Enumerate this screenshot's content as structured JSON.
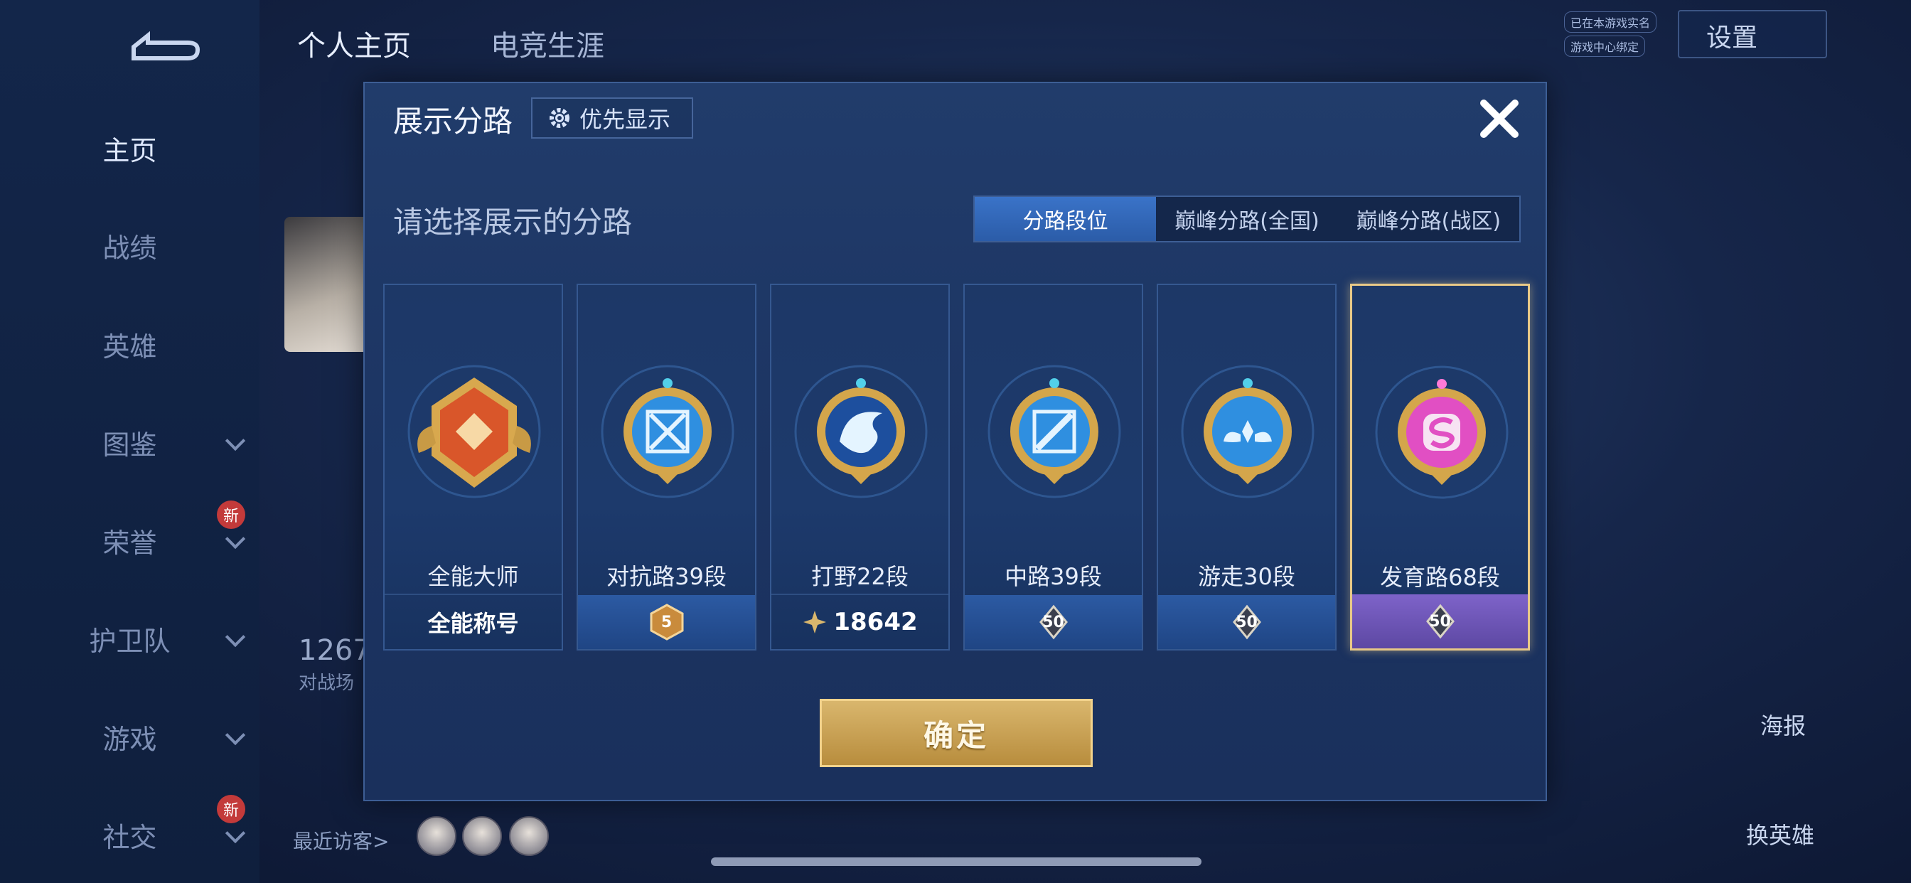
{
  "sidebar": {
    "items": [
      {
        "label": "主页",
        "active": true
      },
      {
        "label": "战绩"
      },
      {
        "label": "英雄"
      },
      {
        "label": "图鉴",
        "has_chevron": true
      },
      {
        "label": "荣誉",
        "has_chevron": true,
        "badge": "新"
      },
      {
        "label": "护卫队",
        "has_chevron": true
      },
      {
        "label": "游戏",
        "has_chevron": true
      },
      {
        "label": "社交",
        "has_chevron": true,
        "badge": "新"
      }
    ]
  },
  "header": {
    "tabs": [
      {
        "label": "个人主页"
      },
      {
        "label": "电竞生涯"
      }
    ],
    "settings_label": "设置",
    "mini_tags": [
      "已在本游戏实名",
      "游戏中心绑定"
    ]
  },
  "background": {
    "stat_number": "1267",
    "stat_label": "对战场",
    "visitors_label": "最近访客>",
    "right_buttons": [
      {
        "label": "海报"
      },
      {
        "label": "换英雄"
      }
    ]
  },
  "modal": {
    "title": "展示分路",
    "priority_label": "优先显示",
    "subtitle": "请选择展示的分路",
    "tabs": [
      {
        "label": "分路段位",
        "active": true
      },
      {
        "label": "巅峰分路(全国)"
      },
      {
        "label": "巅峰分路(战区)"
      }
    ],
    "cards": [
      {
        "lane": "全能大师",
        "footer_type": "text",
        "footer_text": "全能称号",
        "emblem": "orange-emblem"
      },
      {
        "lane": "对抗路39段",
        "footer_type": "rank",
        "rank": "5",
        "emblem": "blue-sword-emblem"
      },
      {
        "lane": "打野22段",
        "footer_type": "score",
        "score": "18642",
        "emblem": "blue-dragon-emblem"
      },
      {
        "lane": "中路39段",
        "footer_type": "rank",
        "rank": "50",
        "emblem": "blue-wand-emblem"
      },
      {
        "lane": "游走30段",
        "footer_type": "rank",
        "rank": "50",
        "emblem": "blue-wing-emblem"
      },
      {
        "lane": "发育路68段",
        "footer_type": "rank",
        "rank": "50",
        "emblem": "pink-emblem",
        "selected": true
      }
    ],
    "confirm_label": "确定"
  },
  "colors": {
    "accent_blue": "#2b5ca8",
    "gold": "#c9a25a",
    "selected_border": "#e8c987",
    "purple_footer": "#6b55b5"
  }
}
